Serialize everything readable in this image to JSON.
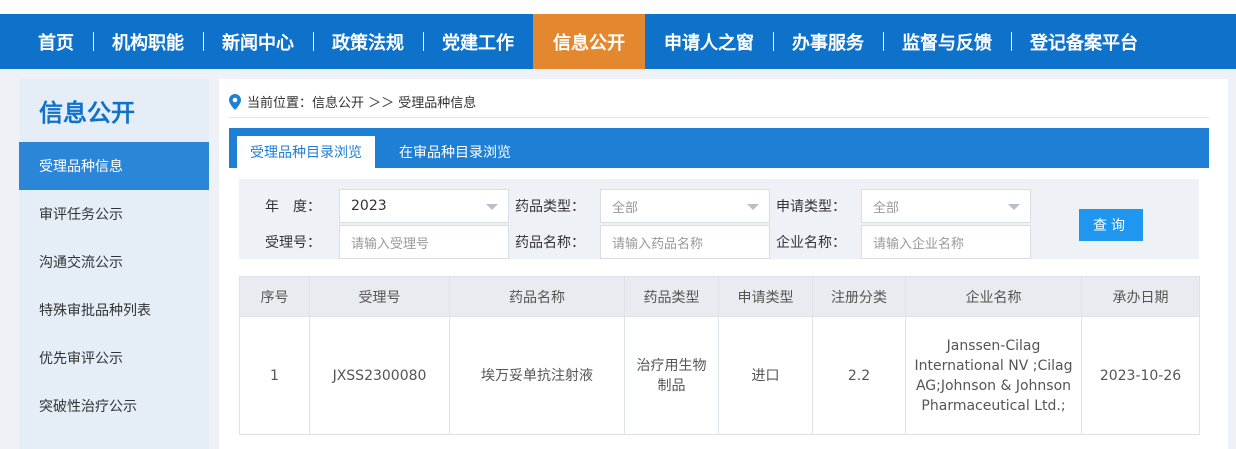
{
  "nav": {
    "items": [
      {
        "label": "首页"
      },
      {
        "label": "机构职能"
      },
      {
        "label": "新闻中心"
      },
      {
        "label": "政策法规"
      },
      {
        "label": "党建工作"
      },
      {
        "label": "信息公开"
      },
      {
        "label": "申请人之窗"
      },
      {
        "label": "办事服务"
      },
      {
        "label": "监督与反馈"
      },
      {
        "label": "登记备案平台"
      }
    ],
    "active_color": "#e3882f",
    "bg_color": "#0f72ca"
  },
  "sidebar": {
    "title": "信息公开",
    "items": [
      {
        "label": "受理品种信息"
      },
      {
        "label": "审评任务公示"
      },
      {
        "label": "沟通交流公示"
      },
      {
        "label": "特殊审批品种列表"
      },
      {
        "label": "优先审评公示"
      },
      {
        "label": "突破性治疗公示"
      }
    ]
  },
  "breadcrumb": {
    "text": "当前位置：信息公开 ＞＞ 受理品种信息",
    "icon": "location-pin-icon"
  },
  "tabs": [
    {
      "label": "受理品种目录浏览"
    },
    {
      "label": "在审品种目录浏览"
    }
  ],
  "filter": {
    "year_label": "年　度：",
    "year_value": "2023",
    "drug_type_label": "药品类型：",
    "drug_type_value": "全部",
    "apply_type_label": "申请类型：",
    "apply_type_value": "全部",
    "accept_no_label": "受理号：",
    "accept_no_placeholder": "请输入受理号",
    "drug_name_label": "药品名称：",
    "drug_name_placeholder": "请输入药品名称",
    "company_label": "企业名称：",
    "company_placeholder": "请输入企业名称",
    "query_label": "查询"
  },
  "table": {
    "headers": [
      "序号",
      "受理号",
      "药品名称",
      "药品类型",
      "申请类型",
      "注册分类",
      "企业名称",
      "承办日期"
    ],
    "rows": [
      {
        "no": "1",
        "accept_no": "JXSS2300080",
        "drug_name": "埃万妥单抗注射液",
        "drug_type": "治疗用生物制品",
        "apply_type": "进口",
        "reg_class": "2.2",
        "company": "Janssen-Cilag International NV ;Cilag AG;Johnson & Johnson Pharmaceutical Ltd.;",
        "date": "2023-10-26"
      }
    ]
  }
}
